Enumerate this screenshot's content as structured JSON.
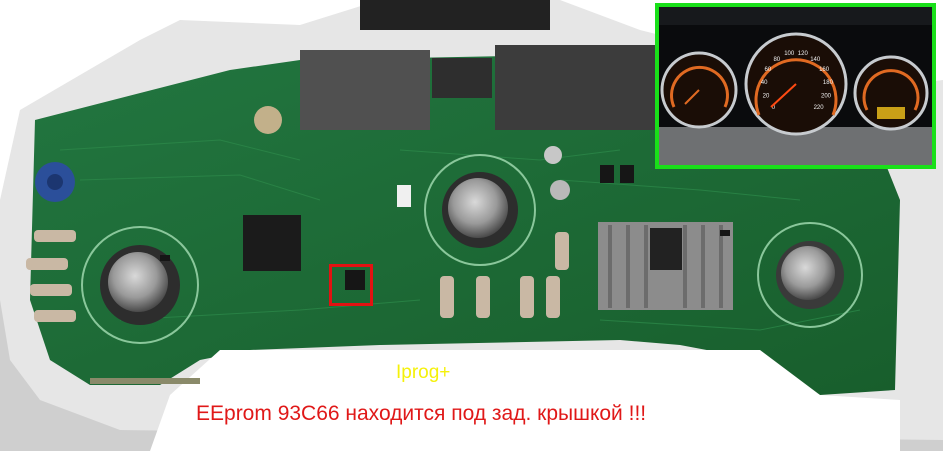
{
  "captions": {
    "programmer": "Iprog+",
    "eeprom_note": "EEprom 93C66 находится под зад. крышкой !!!"
  },
  "colors": {
    "board": "#1d6b33",
    "housing": "#dcdcdc",
    "caption_programmer": "#f5f10a",
    "caption_note": "#e01818",
    "inset_border": "#19e019",
    "chip_marker": "#e21212"
  },
  "inset_gauges": {
    "speedometer_ticks": [
      "0",
      "20",
      "40",
      "60",
      "80",
      "100",
      "120",
      "140",
      "160",
      "180",
      "200",
      "220"
    ]
  }
}
